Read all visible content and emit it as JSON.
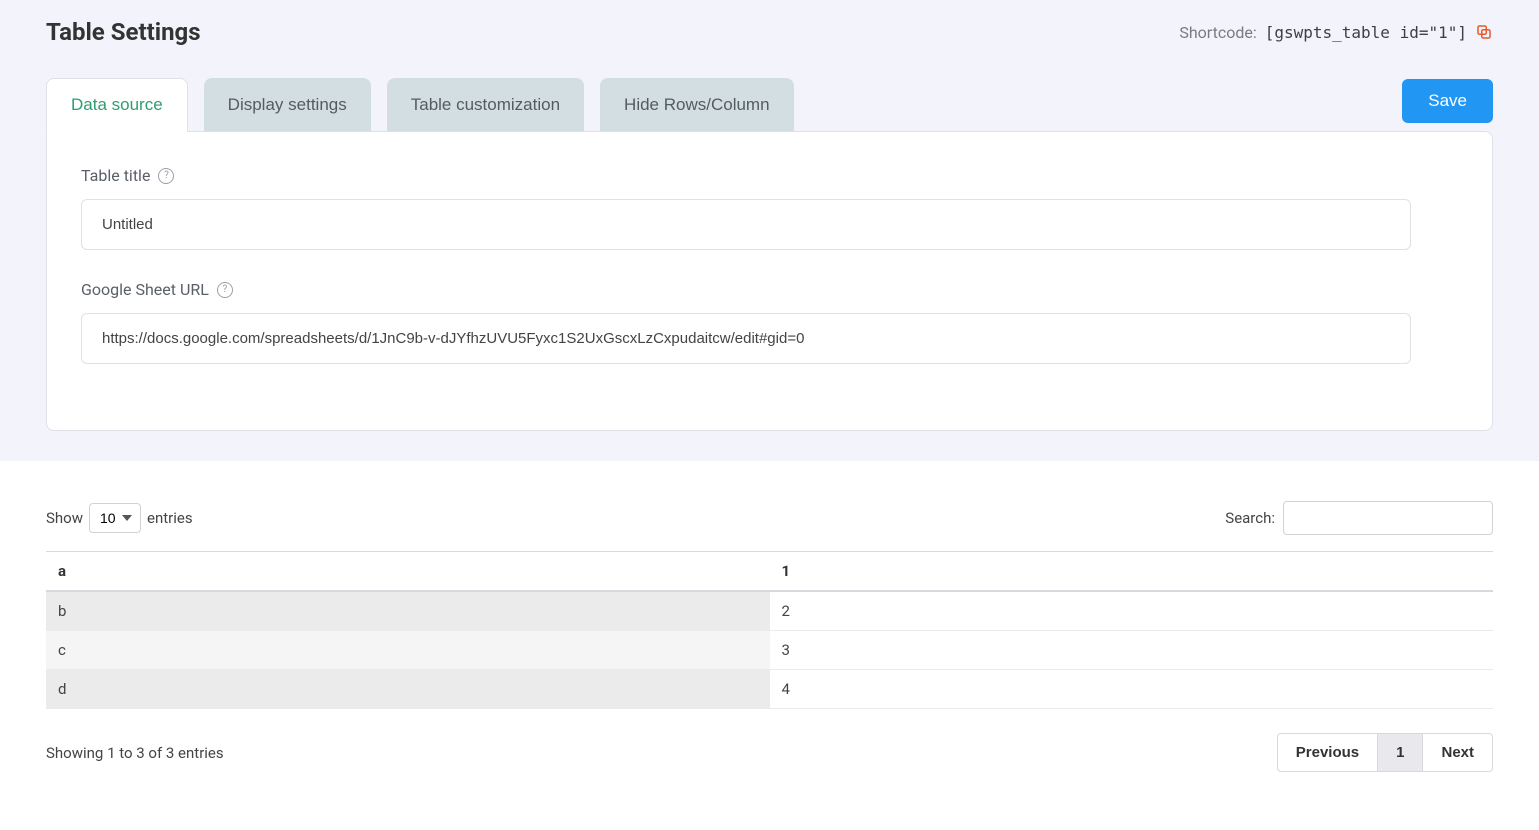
{
  "header": {
    "title": "Table Settings",
    "shortcode_label": "Shortcode:",
    "shortcode_value": "[gswpts_table id=\"1\"]"
  },
  "tabs": {
    "data_source": "Data source",
    "display_settings": "Display settings",
    "table_customization": "Table customization",
    "hide_rows_column": "Hide Rows/Column"
  },
  "actions": {
    "save": "Save"
  },
  "form": {
    "table_title_label": "Table title",
    "table_title_value": "Untitled",
    "sheet_url_label": "Google Sheet URL",
    "sheet_url_value": "https://docs.google.com/spreadsheets/d/1JnC9b-v-dJYfhzUVU5Fyxc1S2UxGscxLzCxpudaitcw/edit#gid=0"
  },
  "datatable": {
    "show_label_prefix": "Show",
    "show_label_suffix": "entries",
    "entries_selected": "10",
    "search_label": "Search:",
    "headers": {
      "col1": "a",
      "col2": "1"
    },
    "rows": [
      {
        "col1": "b",
        "col2": "2"
      },
      {
        "col1": "c",
        "col2": "3"
      },
      {
        "col1": "d",
        "col2": "4"
      }
    ],
    "info": "Showing 1 to 3 of 3 entries",
    "pagination": {
      "previous": "Previous",
      "page1": "1",
      "next": "Next"
    }
  }
}
